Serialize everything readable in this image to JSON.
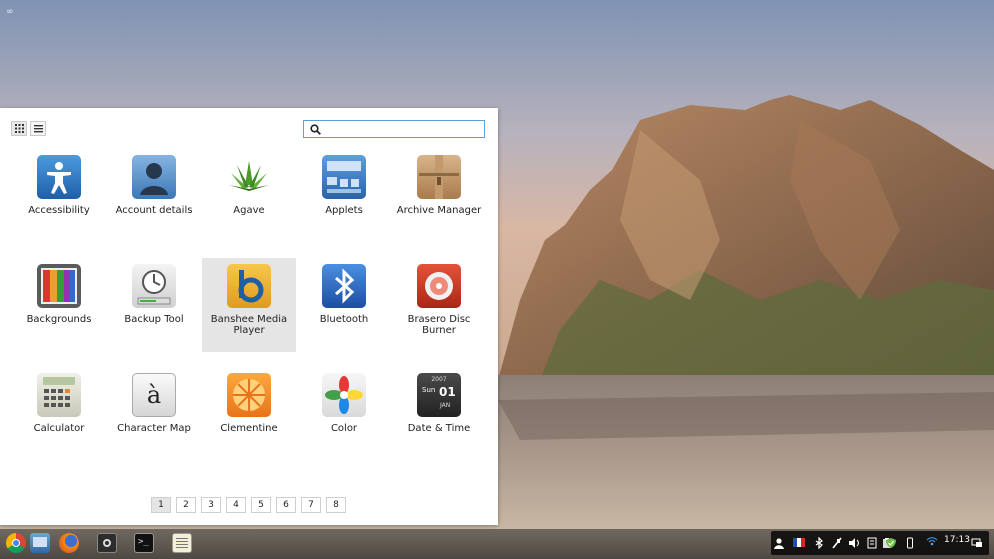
{
  "search": {
    "value": "",
    "placeholder": ""
  },
  "view_toggle": {
    "grid_icon": "grid-icon",
    "list_icon": "list-icon"
  },
  "apps": [
    {
      "label": "Accessibility",
      "icon": "accessibility-icon"
    },
    {
      "label": "Account details",
      "icon": "account-icon"
    },
    {
      "label": "Agave",
      "icon": "agave-icon"
    },
    {
      "label": "Applets",
      "icon": "applets-icon"
    },
    {
      "label": "Archive Manager",
      "icon": "archive-icon"
    },
    {
      "label": "Backgrounds",
      "icon": "backgrounds-icon"
    },
    {
      "label": "Backup Tool",
      "icon": "backup-icon"
    },
    {
      "label": "Banshee Media Player",
      "icon": "banshee-icon"
    },
    {
      "label": "Bluetooth",
      "icon": "bluetooth-icon"
    },
    {
      "label": "Brasero Disc Burner",
      "icon": "brasero-icon"
    },
    {
      "label": "Calculator",
      "icon": "calculator-icon"
    },
    {
      "label": "Character Map",
      "icon": "charmap-icon"
    },
    {
      "label": "Clementine",
      "icon": "clementine-icon"
    },
    {
      "label": "Color",
      "icon": "color-icon"
    },
    {
      "label": "Date & Time",
      "icon": "datetime-icon"
    }
  ],
  "icon_text": {
    "charmap": "à",
    "date_year": "2007",
    "date_day": "Sun",
    "date_num": "01",
    "date_month": "JAN"
  },
  "pager": [
    "1",
    "2",
    "3",
    "4",
    "5",
    "6",
    "7",
    "8"
  ],
  "taskbar": [
    "chrome-icon",
    "files-icon",
    "firefox-icon",
    "screenshot-icon",
    "terminal-icon",
    "text-editor-icon"
  ],
  "tray": {
    "clock": "17:13",
    "keyboard_layout_icon": "french-flag-icon"
  }
}
